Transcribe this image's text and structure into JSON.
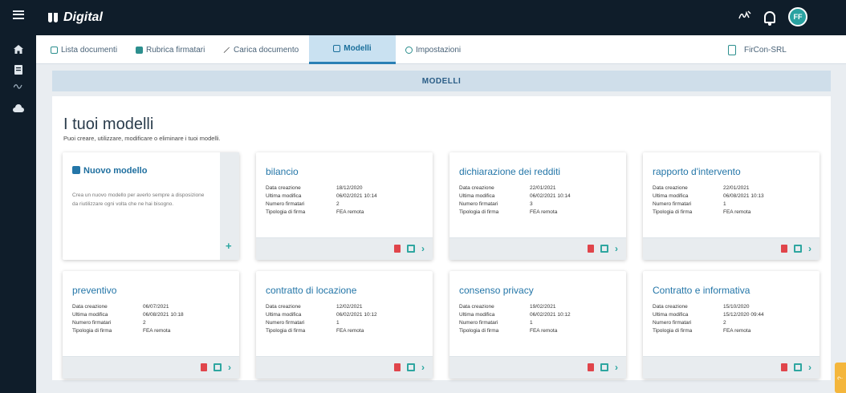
{
  "header": {
    "brand": "Digital"
  },
  "sidebar": {
    "items": [
      {
        "icon": "menu-icon"
      },
      {
        "icon": "home-icon"
      },
      {
        "icon": "document-icon"
      },
      {
        "icon": "signature-icon"
      },
      {
        "icon": "cloud-icon"
      }
    ]
  },
  "nav": {
    "tabs": [
      {
        "label": "Lista documenti"
      },
      {
        "label": "Rubrica firmatari"
      },
      {
        "label": "Carica documento"
      },
      {
        "label": "Modelli"
      },
      {
        "label": "Impostazioni"
      }
    ],
    "right_label": "FirCon-SRL"
  },
  "section": {
    "title": "MODELLI"
  },
  "main": {
    "title": "I tuoi modelli",
    "subtitle": "Puoi creare, utilizzare, modificare o eliminare i tuoi modelli."
  },
  "new_card": {
    "title": "Nuovo modello",
    "description": "Crea un nuovo modello per averlo sempre a disposizione da riutilizzare ogni volta che ne hai bisogno."
  },
  "labels": {
    "created": "Data creazione",
    "modified": "Ultima modifica",
    "signers": "Numero firmatari",
    "sign_type": "Tipologia di firma"
  },
  "cards": [
    {
      "title": "bilancio",
      "created": "18/12/2020",
      "modified": "06/02/2021 10:14",
      "signers": "2",
      "sign_type": "FEA remota"
    },
    {
      "title": "dichiarazione dei redditi",
      "created": "22/01/2021",
      "modified": "06/02/2021 10:14",
      "signers": "3",
      "sign_type": "FEA remota"
    },
    {
      "title": "rapporto d'intervento",
      "created": "22/01/2021",
      "modified": "06/08/2021 10:13",
      "signers": "1",
      "sign_type": "FEA remota"
    },
    {
      "title": "preventivo",
      "created": "06/07/2021",
      "modified": "06/08/2021 10:18",
      "signers": "2",
      "sign_type": "FEA remota"
    },
    {
      "title": "contratto di locazione",
      "created": "12/02/2021",
      "modified": "06/02/2021 10:12",
      "signers": "1",
      "sign_type": "FEA remota"
    },
    {
      "title": "consenso privacy",
      "created": "19/02/2021",
      "modified": "06/02/2021 10:12",
      "signers": "1",
      "sign_type": "FEA remota"
    },
    {
      "title": "Contratto e informativa",
      "created": "15/10/2020",
      "modified": "15/12/2020 09:44",
      "signers": "2",
      "sign_type": "FEA remota"
    }
  ],
  "user": {
    "initials": "FF"
  },
  "colors": {
    "topbar": "#0f1d2a",
    "accent": "#2476a8",
    "teal": "#2aa6a0",
    "delete": "#e0454b",
    "help": "#f4b63c"
  }
}
